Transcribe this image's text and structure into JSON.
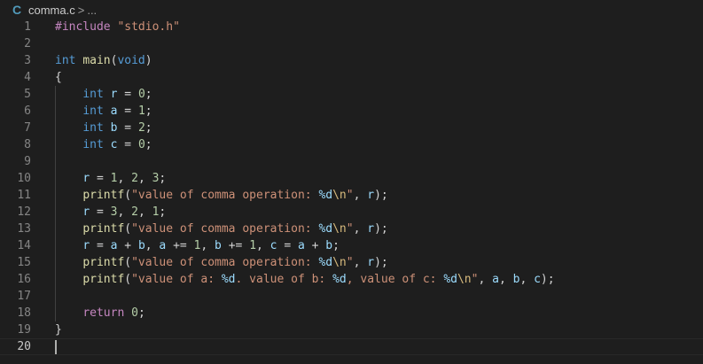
{
  "breadcrumb": {
    "lang_icon": "C",
    "file_name": "comma.c",
    "separator": ">",
    "more": "..."
  },
  "editor": {
    "current_line": 20,
    "lines": [
      {
        "n": "1",
        "tokens": [
          [
            "tk-ctrl",
            "#include"
          ],
          [
            "tk-plain",
            " "
          ],
          [
            "tk-str",
            "\"stdio.h\""
          ]
        ]
      },
      {
        "n": "2",
        "tokens": []
      },
      {
        "n": "3",
        "tokens": [
          [
            "tk-kw",
            "int"
          ],
          [
            "tk-plain",
            " "
          ],
          [
            "tk-fn",
            "main"
          ],
          [
            "tk-plain",
            "("
          ],
          [
            "tk-kw",
            "void"
          ],
          [
            "tk-plain",
            ")"
          ]
        ]
      },
      {
        "n": "4",
        "tokens": [
          [
            "tk-plain",
            "{"
          ]
        ]
      },
      {
        "n": "5",
        "tokens": [
          [
            "tk-plain",
            "    "
          ],
          [
            "tk-kw",
            "int"
          ],
          [
            "tk-plain",
            " "
          ],
          [
            "tk-var",
            "r"
          ],
          [
            "tk-plain",
            " = "
          ],
          [
            "tk-num",
            "0"
          ],
          [
            "tk-plain",
            ";"
          ]
        ]
      },
      {
        "n": "6",
        "tokens": [
          [
            "tk-plain",
            "    "
          ],
          [
            "tk-kw",
            "int"
          ],
          [
            "tk-plain",
            " "
          ],
          [
            "tk-var",
            "a"
          ],
          [
            "tk-plain",
            " = "
          ],
          [
            "tk-num",
            "1"
          ],
          [
            "tk-plain",
            ";"
          ]
        ]
      },
      {
        "n": "7",
        "tokens": [
          [
            "tk-plain",
            "    "
          ],
          [
            "tk-kw",
            "int"
          ],
          [
            "tk-plain",
            " "
          ],
          [
            "tk-var",
            "b"
          ],
          [
            "tk-plain",
            " = "
          ],
          [
            "tk-num",
            "2"
          ],
          [
            "tk-plain",
            ";"
          ]
        ]
      },
      {
        "n": "8",
        "tokens": [
          [
            "tk-plain",
            "    "
          ],
          [
            "tk-kw",
            "int"
          ],
          [
            "tk-plain",
            " "
          ],
          [
            "tk-var",
            "c"
          ],
          [
            "tk-plain",
            " = "
          ],
          [
            "tk-num",
            "0"
          ],
          [
            "tk-plain",
            ";"
          ]
        ]
      },
      {
        "n": "9",
        "tokens": []
      },
      {
        "n": "10",
        "tokens": [
          [
            "tk-plain",
            "    "
          ],
          [
            "tk-var",
            "r"
          ],
          [
            "tk-plain",
            " = "
          ],
          [
            "tk-num",
            "1"
          ],
          [
            "tk-plain",
            ", "
          ],
          [
            "tk-num",
            "2"
          ],
          [
            "tk-plain",
            ", "
          ],
          [
            "tk-num",
            "3"
          ],
          [
            "tk-plain",
            ";"
          ]
        ]
      },
      {
        "n": "11",
        "tokens": [
          [
            "tk-plain",
            "    "
          ],
          [
            "tk-fn",
            "printf"
          ],
          [
            "tk-plain",
            "("
          ],
          [
            "tk-str",
            "\"value of comma operation: "
          ],
          [
            "tk-var",
            "%d"
          ],
          [
            "tk-esc",
            "\\n"
          ],
          [
            "tk-str",
            "\""
          ],
          [
            "tk-plain",
            ", "
          ],
          [
            "tk-var",
            "r"
          ],
          [
            "tk-plain",
            ");"
          ]
        ]
      },
      {
        "n": "12",
        "tokens": [
          [
            "tk-plain",
            "    "
          ],
          [
            "tk-var",
            "r"
          ],
          [
            "tk-plain",
            " = "
          ],
          [
            "tk-num",
            "3"
          ],
          [
            "tk-plain",
            ", "
          ],
          [
            "tk-num",
            "2"
          ],
          [
            "tk-plain",
            ", "
          ],
          [
            "tk-num",
            "1"
          ],
          [
            "tk-plain",
            ";"
          ]
        ]
      },
      {
        "n": "13",
        "tokens": [
          [
            "tk-plain",
            "    "
          ],
          [
            "tk-fn",
            "printf"
          ],
          [
            "tk-plain",
            "("
          ],
          [
            "tk-str",
            "\"value of comma operation: "
          ],
          [
            "tk-var",
            "%d"
          ],
          [
            "tk-esc",
            "\\n"
          ],
          [
            "tk-str",
            "\""
          ],
          [
            "tk-plain",
            ", "
          ],
          [
            "tk-var",
            "r"
          ],
          [
            "tk-plain",
            ");"
          ]
        ]
      },
      {
        "n": "14",
        "tokens": [
          [
            "tk-plain",
            "    "
          ],
          [
            "tk-var",
            "r"
          ],
          [
            "tk-plain",
            " = "
          ],
          [
            "tk-var",
            "a"
          ],
          [
            "tk-plain",
            " + "
          ],
          [
            "tk-var",
            "b"
          ],
          [
            "tk-plain",
            ", "
          ],
          [
            "tk-var",
            "a"
          ],
          [
            "tk-plain",
            " += "
          ],
          [
            "tk-num",
            "1"
          ],
          [
            "tk-plain",
            ", "
          ],
          [
            "tk-var",
            "b"
          ],
          [
            "tk-plain",
            " += "
          ],
          [
            "tk-num",
            "1"
          ],
          [
            "tk-plain",
            ", "
          ],
          [
            "tk-var",
            "c"
          ],
          [
            "tk-plain",
            " = "
          ],
          [
            "tk-var",
            "a"
          ],
          [
            "tk-plain",
            " + "
          ],
          [
            "tk-var",
            "b"
          ],
          [
            "tk-plain",
            ";"
          ]
        ]
      },
      {
        "n": "15",
        "tokens": [
          [
            "tk-plain",
            "    "
          ],
          [
            "tk-fn",
            "printf"
          ],
          [
            "tk-plain",
            "("
          ],
          [
            "tk-str",
            "\"value of comma operation: "
          ],
          [
            "tk-var",
            "%d"
          ],
          [
            "tk-esc",
            "\\n"
          ],
          [
            "tk-str",
            "\""
          ],
          [
            "tk-plain",
            ", "
          ],
          [
            "tk-var",
            "r"
          ],
          [
            "tk-plain",
            ");"
          ]
        ]
      },
      {
        "n": "16",
        "tokens": [
          [
            "tk-plain",
            "    "
          ],
          [
            "tk-fn",
            "printf"
          ],
          [
            "tk-plain",
            "("
          ],
          [
            "tk-str",
            "\"value of a: "
          ],
          [
            "tk-var",
            "%d"
          ],
          [
            "tk-str",
            ". value of b: "
          ],
          [
            "tk-var",
            "%d"
          ],
          [
            "tk-str",
            ", value of c: "
          ],
          [
            "tk-var",
            "%d"
          ],
          [
            "tk-esc",
            "\\n"
          ],
          [
            "tk-str",
            "\""
          ],
          [
            "tk-plain",
            ", "
          ],
          [
            "tk-var",
            "a"
          ],
          [
            "tk-plain",
            ", "
          ],
          [
            "tk-var",
            "b"
          ],
          [
            "tk-plain",
            ", "
          ],
          [
            "tk-var",
            "c"
          ],
          [
            "tk-plain",
            ");"
          ]
        ]
      },
      {
        "n": "17",
        "tokens": []
      },
      {
        "n": "18",
        "tokens": [
          [
            "tk-plain",
            "    "
          ],
          [
            "tk-ctrl",
            "return"
          ],
          [
            "tk-plain",
            " "
          ],
          [
            "tk-num",
            "0"
          ],
          [
            "tk-plain",
            ";"
          ]
        ]
      },
      {
        "n": "19",
        "tokens": [
          [
            "tk-plain",
            "}"
          ]
        ]
      },
      {
        "n": "20",
        "tokens": []
      }
    ]
  }
}
